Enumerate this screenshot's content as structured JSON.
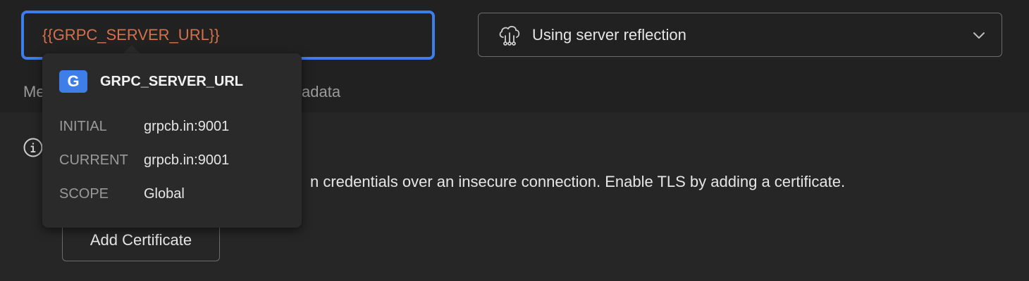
{
  "request": {
    "url_value": "{{GRPC_SERVER_URL}}",
    "method_label": "Using server reflection"
  },
  "tabs": {
    "left_fragment": "Me",
    "right_fragment": "adata"
  },
  "tls_notice": {
    "text": "n credentials over an insecure connection. Enable TLS by adding a certificate.",
    "button_label": "Add Certificate"
  },
  "variable_tooltip": {
    "badge": "G",
    "name": "GRPC_SERVER_URL",
    "rows": [
      {
        "label": "INITIAL",
        "value": "grpcb.in:9001"
      },
      {
        "label": "CURRENT",
        "value": "grpcb.in:9001"
      },
      {
        "label": "SCOPE",
        "value": "Global"
      }
    ]
  },
  "colors": {
    "accent": "#3d7ee8",
    "variable_text": "#d4704a",
    "background": "#212121"
  },
  "icons": {
    "method": "cloud-reflection-icon",
    "dropdown": "chevron-down-icon",
    "info": "info-icon"
  }
}
